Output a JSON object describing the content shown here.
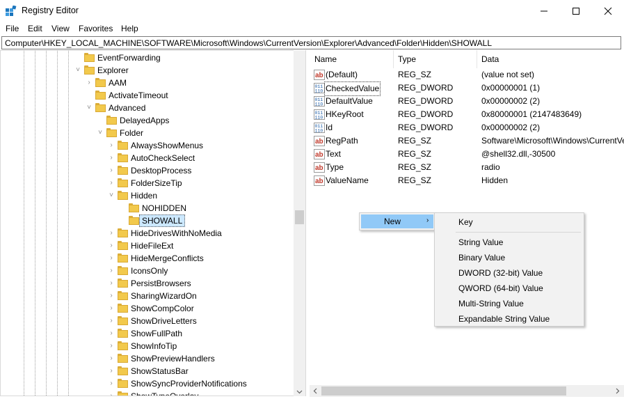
{
  "window": {
    "title": "Registry Editor"
  },
  "menu": [
    "File",
    "Edit",
    "View",
    "Favorites",
    "Help"
  ],
  "address": "Computer\\HKEY_LOCAL_MACHINE\\SOFTWARE\\Microsoft\\Windows\\CurrentVersion\\Explorer\\Advanced\\Folder\\Hidden\\SHOWALL",
  "tree": [
    {
      "label": "EventForwarding",
      "level": 0,
      "expander": ""
    },
    {
      "label": "Explorer",
      "level": 0,
      "expander": "˅"
    },
    {
      "label": "AAM",
      "level": 1,
      "expander": "›"
    },
    {
      "label": "ActivateTimeout",
      "level": 1,
      "expander": ""
    },
    {
      "label": "Advanced",
      "level": 1,
      "expander": "˅"
    },
    {
      "label": "DelayedApps",
      "level": 2,
      "expander": ""
    },
    {
      "label": "Folder",
      "level": 2,
      "expander": "˅"
    },
    {
      "label": "AlwaysShowMenus",
      "level": 3,
      "expander": "›"
    },
    {
      "label": "AutoCheckSelect",
      "level": 3,
      "expander": "›"
    },
    {
      "label": "DesktopProcess",
      "level": 3,
      "expander": "›"
    },
    {
      "label": "FolderSizeTip",
      "level": 3,
      "expander": "›"
    },
    {
      "label": "Hidden",
      "level": 3,
      "expander": "˅"
    },
    {
      "label": "NOHIDDEN",
      "level": 4,
      "expander": ""
    },
    {
      "label": "SHOWALL",
      "level": 4,
      "expander": "",
      "selected": true
    },
    {
      "label": "HideDrivesWithNoMedia",
      "level": 3,
      "expander": "›"
    },
    {
      "label": "HideFileExt",
      "level": 3,
      "expander": "›"
    },
    {
      "label": "HideMergeConflicts",
      "level": 3,
      "expander": "›"
    },
    {
      "label": "IconsOnly",
      "level": 3,
      "expander": "›"
    },
    {
      "label": "PersistBrowsers",
      "level": 3,
      "expander": "›"
    },
    {
      "label": "SharingWizardOn",
      "level": 3,
      "expander": "›"
    },
    {
      "label": "ShowCompColor",
      "level": 3,
      "expander": "›"
    },
    {
      "label": "ShowDriveLetters",
      "level": 3,
      "expander": "›"
    },
    {
      "label": "ShowFullPath",
      "level": 3,
      "expander": "›"
    },
    {
      "label": "ShowInfoTip",
      "level": 3,
      "expander": "›"
    },
    {
      "label": "ShowPreviewHandlers",
      "level": 3,
      "expander": "›"
    },
    {
      "label": "ShowStatusBar",
      "level": 3,
      "expander": "›"
    },
    {
      "label": "ShowSyncProviderNotifications",
      "level": 3,
      "expander": "›"
    },
    {
      "label": "ShowTypeOverlay",
      "level": 3,
      "expander": "›"
    }
  ],
  "columns": {
    "name": "Name",
    "type": "Type",
    "data": "Data"
  },
  "values": [
    {
      "name": "(Default)",
      "type": "REG_SZ",
      "data": "(value not set)",
      "icon": "string-value-icon"
    },
    {
      "name": "CheckedValue",
      "type": "REG_DWORD",
      "data": "0x00000001 (1)",
      "icon": "binary-value-icon",
      "focused": true
    },
    {
      "name": "DefaultValue",
      "type": "REG_DWORD",
      "data": "0x00000002 (2)",
      "icon": "binary-value-icon"
    },
    {
      "name": "HKeyRoot",
      "type": "REG_DWORD",
      "data": "0x80000001 (2147483649)",
      "icon": "binary-value-icon"
    },
    {
      "name": "Id",
      "type": "REG_DWORD",
      "data": "0x00000002 (2)",
      "icon": "binary-value-icon"
    },
    {
      "name": "RegPath",
      "type": "REG_SZ",
      "data": "Software\\Microsoft\\Windows\\CurrentVersion",
      "icon": "string-value-icon"
    },
    {
      "name": "Text",
      "type": "REG_SZ",
      "data": "@shell32.dll,-30500",
      "icon": "string-value-icon"
    },
    {
      "name": "Type",
      "type": "REG_SZ",
      "data": "radio",
      "icon": "string-value-icon"
    },
    {
      "name": "ValueName",
      "type": "REG_SZ",
      "data": "Hidden",
      "icon": "string-value-icon"
    }
  ],
  "context_menu": {
    "new_label": "New",
    "arrow": "›"
  },
  "submenu": {
    "key": "Key",
    "items": [
      "String Value",
      "Binary Value",
      "DWORD (32-bit) Value",
      "QWORD (64-bit) Value",
      "Multi-String Value",
      "Expandable String Value"
    ]
  },
  "colors": {
    "highlight": "#91c9f7",
    "selection": "#cce8ff",
    "folder": "#f2c94c",
    "string_icon": "#c0392b",
    "binary_icon": "#1f5fa8"
  }
}
